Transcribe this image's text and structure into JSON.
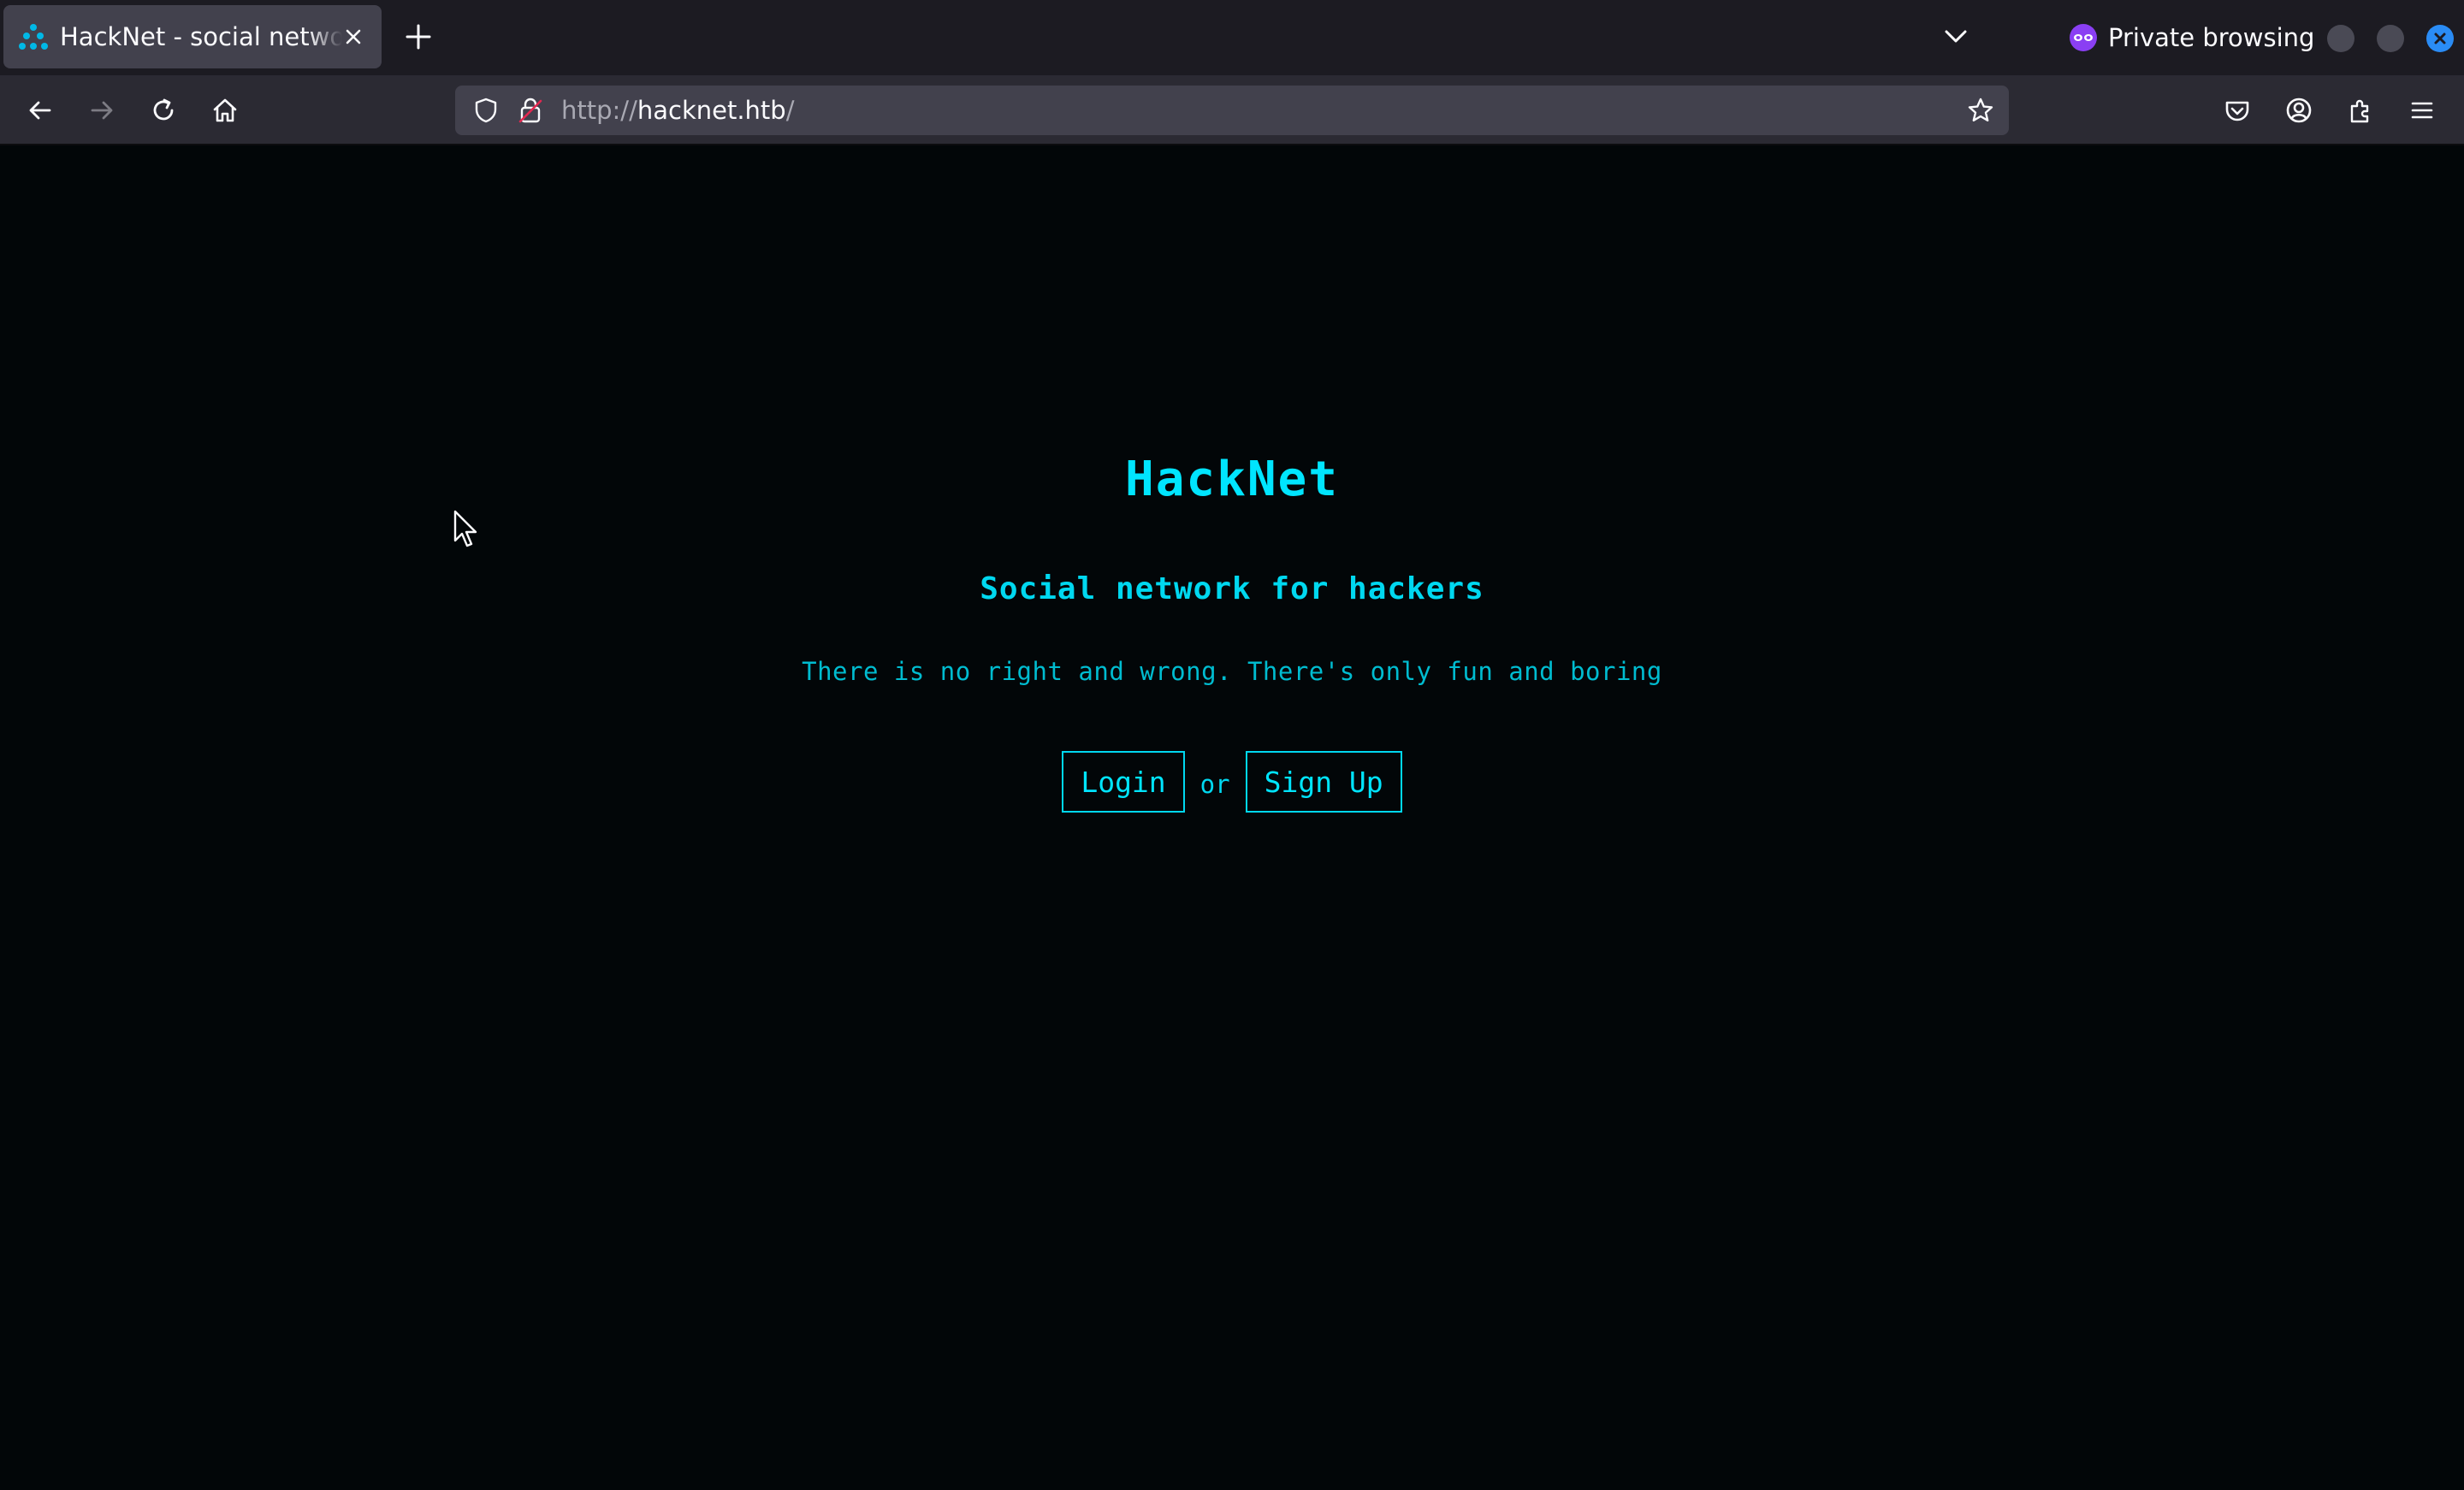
{
  "browser": {
    "tab": {
      "title": "HackNet - social network for hackers"
    },
    "private_label": "Private browsing",
    "url": {
      "scheme": "http://",
      "host": "hacknet.htb",
      "path": "/"
    }
  },
  "site": {
    "title": "HackNet",
    "subtitle": "Social network for hackers",
    "tagline": "There is no right and wrong. There's only fun and boring",
    "login_label": "Login",
    "or_label": "or",
    "signup_label": "Sign Up"
  },
  "colors": {
    "accent": "#00e5ff",
    "page_bg": "#020608",
    "private_purple": "#8a3ff3",
    "close_blue": "#2a8cf5"
  },
  "icons": [
    "hacknet-favicon",
    "close-icon",
    "plus-icon",
    "chevron-down-icon",
    "private-mask-icon",
    "back-arrow-icon",
    "forward-arrow-icon",
    "reload-icon",
    "home-icon",
    "shield-icon",
    "insecure-lock-icon",
    "star-icon",
    "pocket-icon",
    "account-icon",
    "extensions-icon",
    "hamburger-menu-icon",
    "mouse-cursor-icon"
  ]
}
